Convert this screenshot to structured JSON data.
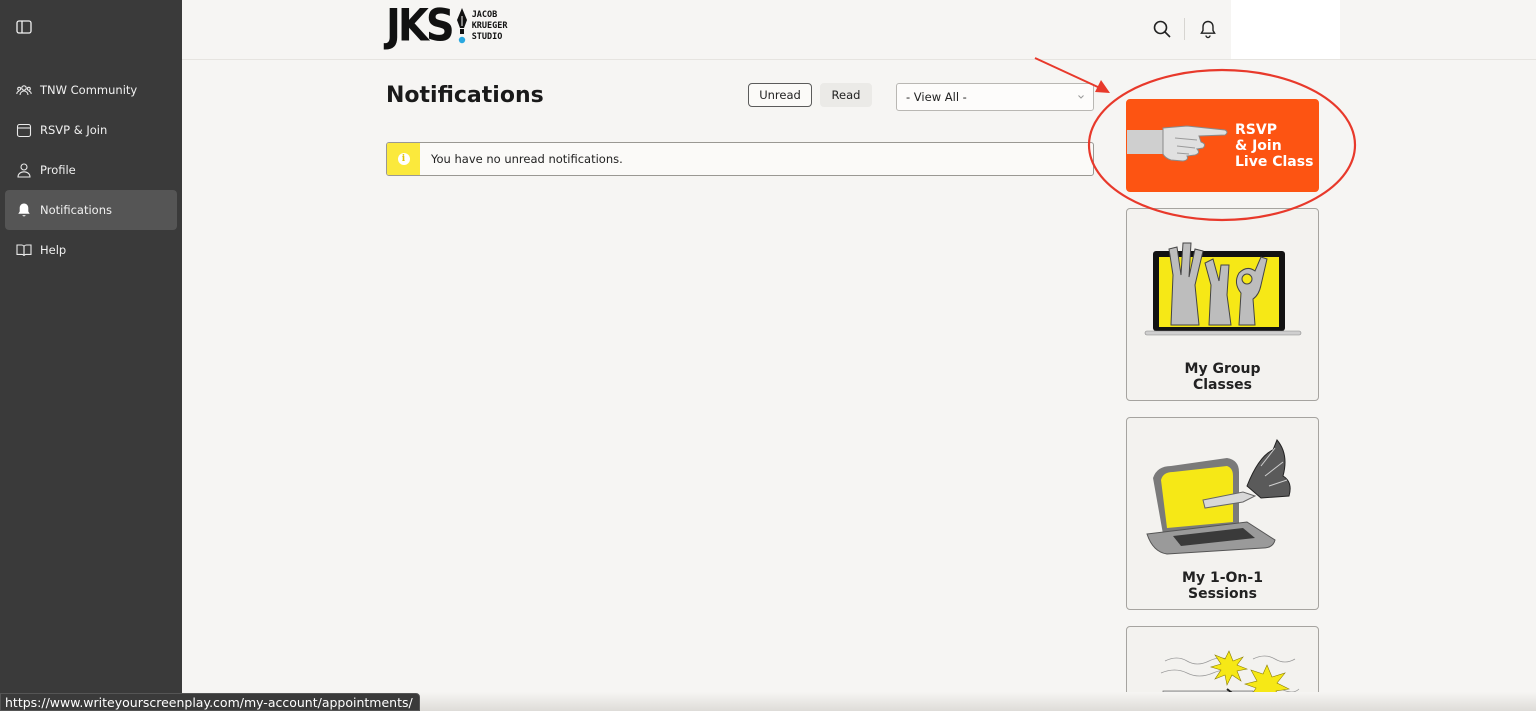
{
  "sidebar": {
    "toggle_icon": "sidebar-toggle-icon",
    "items": [
      {
        "label": "TNW Community",
        "icon": "community-icon",
        "active": false
      },
      {
        "label": "RSVP & Join",
        "icon": "calendar-icon",
        "active": false
      },
      {
        "label": "Profile",
        "icon": "user-icon",
        "active": false
      },
      {
        "label": "Notifications",
        "icon": "bell-icon",
        "active": true
      },
      {
        "label": "Help",
        "icon": "book-icon",
        "active": false
      }
    ]
  },
  "header": {
    "logo": {
      "letters": "JKS",
      "line1": "JACOB",
      "line2": "KRUEGER",
      "line3": "STUDIO"
    },
    "search_icon": "search-icon",
    "bell_icon": "bell-icon"
  },
  "main": {
    "title": "Notifications",
    "filters": {
      "unread": "Unread",
      "read": "Read"
    },
    "select": {
      "value": "- View All -"
    },
    "notice": {
      "text": "You have no unread notifications.",
      "icon": "info-icon"
    }
  },
  "cards": {
    "rsvp": {
      "line1": "RSVP",
      "line2": "& Join",
      "line3": "Live Class",
      "color": "#fd5412"
    },
    "group": {
      "line1": "My Group",
      "line2": "Classes"
    },
    "one_on_one": {
      "line1": "My 1-On-1",
      "line2": "Sessions"
    }
  },
  "colors": {
    "sidebar_bg": "#3a3a3a",
    "accent_orange": "#fd5412",
    "notice_yellow": "#fbe93c",
    "annotation_red": "#e8392b"
  },
  "statusbar": {
    "url": "https://www.writeyourscreenplay.com/my-account/appointments/"
  }
}
